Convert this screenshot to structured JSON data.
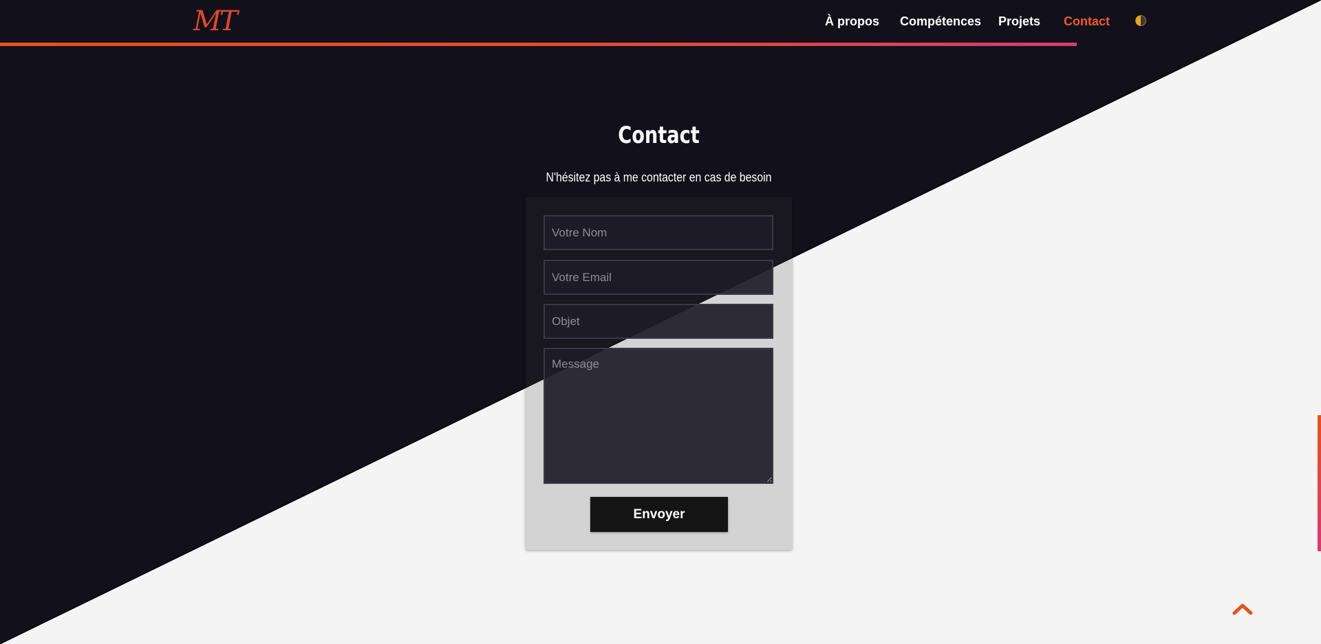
{
  "header": {
    "logo_text": "MT",
    "nav_items": [
      {
        "label": "À propos",
        "active": false
      },
      {
        "label": "Compétences",
        "active": false
      },
      {
        "label": "Projets",
        "active": false
      },
      {
        "label": "Contact",
        "active": true
      }
    ],
    "theme_toggle_icon": "half-moon-icon"
  },
  "scroll_progress": 0.815,
  "contact": {
    "title": "Contact",
    "subtitle": "N'hésitez pas à me contacter en cas de besoin",
    "fields": {
      "name_placeholder": "Votre Nom",
      "email_placeholder": "Votre Email",
      "subject_placeholder": "Objet",
      "message_placeholder": "Message"
    },
    "submit_label": "Envoyer"
  },
  "back_to_top_icon": "chevron-up-icon",
  "colors": {
    "dark_bg": "#12101b",
    "light_bg": "#f4f4f4",
    "accent": "#f0582a",
    "accent_pink": "#d63a72"
  }
}
